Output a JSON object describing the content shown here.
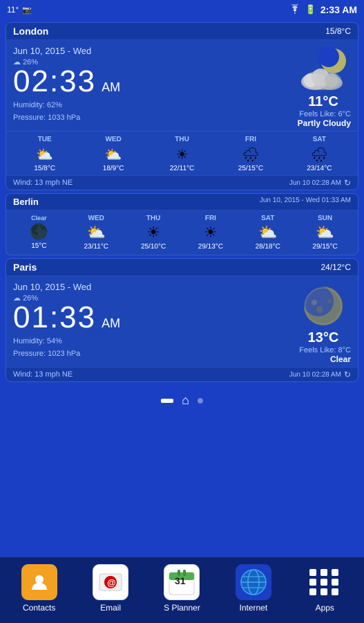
{
  "statusBar": {
    "batteryLevel": "11°",
    "time": "2:33 AM",
    "wifiIcon": "wifi",
    "batteryIcon": "battery"
  },
  "london": {
    "cityName": "London",
    "tempRange": "15/8°C",
    "date": "Jun 10, 2015 - Wed",
    "humidity_icon": "☁",
    "humidity_pct": "26%",
    "time": "02:33",
    "ampm": "AM",
    "temp": "11°C",
    "feels_like": "Feels Like: 6°C",
    "condition": "Partly Cloudy",
    "humidity": "Humidity: 62%",
    "pressure": "Pressure: 1033 hPa",
    "wind": "Wind: 13 mph NE",
    "updated": "Jun 10  02:28 AM",
    "forecast": [
      {
        "day": "TUE",
        "icon": "⛅",
        "temp": "15/8°C"
      },
      {
        "day": "WED",
        "icon": "🌤",
        "temp": "18/9°C"
      },
      {
        "day": "THU",
        "icon": "☀",
        "temp": "22/11°C"
      },
      {
        "day": "FRI",
        "icon": "🌧",
        "temp": "25/15°C"
      },
      {
        "day": "SAT",
        "icon": "🌧",
        "temp": "23/14°C"
      }
    ]
  },
  "berlin": {
    "cityName": "Berlin",
    "headerRight": "Jun 10, 2015 - Wed 01:33 AM",
    "clearLabel": "Clear",
    "forecast": [
      {
        "day": "—",
        "label": "Clear",
        "icon": "🌙",
        "temp": "15°C"
      },
      {
        "day": "WED",
        "icon": "⛅",
        "temp": "23/11°C"
      },
      {
        "day": "THU",
        "icon": "☀",
        "temp": "25/10°C"
      },
      {
        "day": "FRI",
        "icon": "☀",
        "temp": "29/13°C"
      },
      {
        "day": "SAT",
        "icon": "⛅",
        "temp": "28/18°C"
      },
      {
        "day": "SUN",
        "icon": "⛅",
        "temp": "29/15°C"
      }
    ]
  },
  "paris": {
    "cityName": "Paris",
    "tempRange": "24/12°C",
    "date": "Jun 10, 2015 - Wed",
    "humidity_icon": "☁",
    "humidity_pct": "26%",
    "time": "01:33",
    "ampm": "AM",
    "temp": "13°C",
    "feels_like": "Feels Like: 8°C",
    "condition": "Clear",
    "humidity": "Humidity: 54%",
    "pressure": "Pressure: 1023 hPa",
    "wind": "Wind: 13 mph NE",
    "updated": "Jun 10  02:28 AM"
  },
  "dock": {
    "items": [
      {
        "name": "Contacts",
        "icon": "contacts"
      },
      {
        "name": "Email",
        "icon": "email"
      },
      {
        "name": "S Planner",
        "icon": "splanner"
      },
      {
        "name": "Internet",
        "icon": "internet"
      },
      {
        "name": "Apps",
        "icon": "apps"
      }
    ]
  }
}
